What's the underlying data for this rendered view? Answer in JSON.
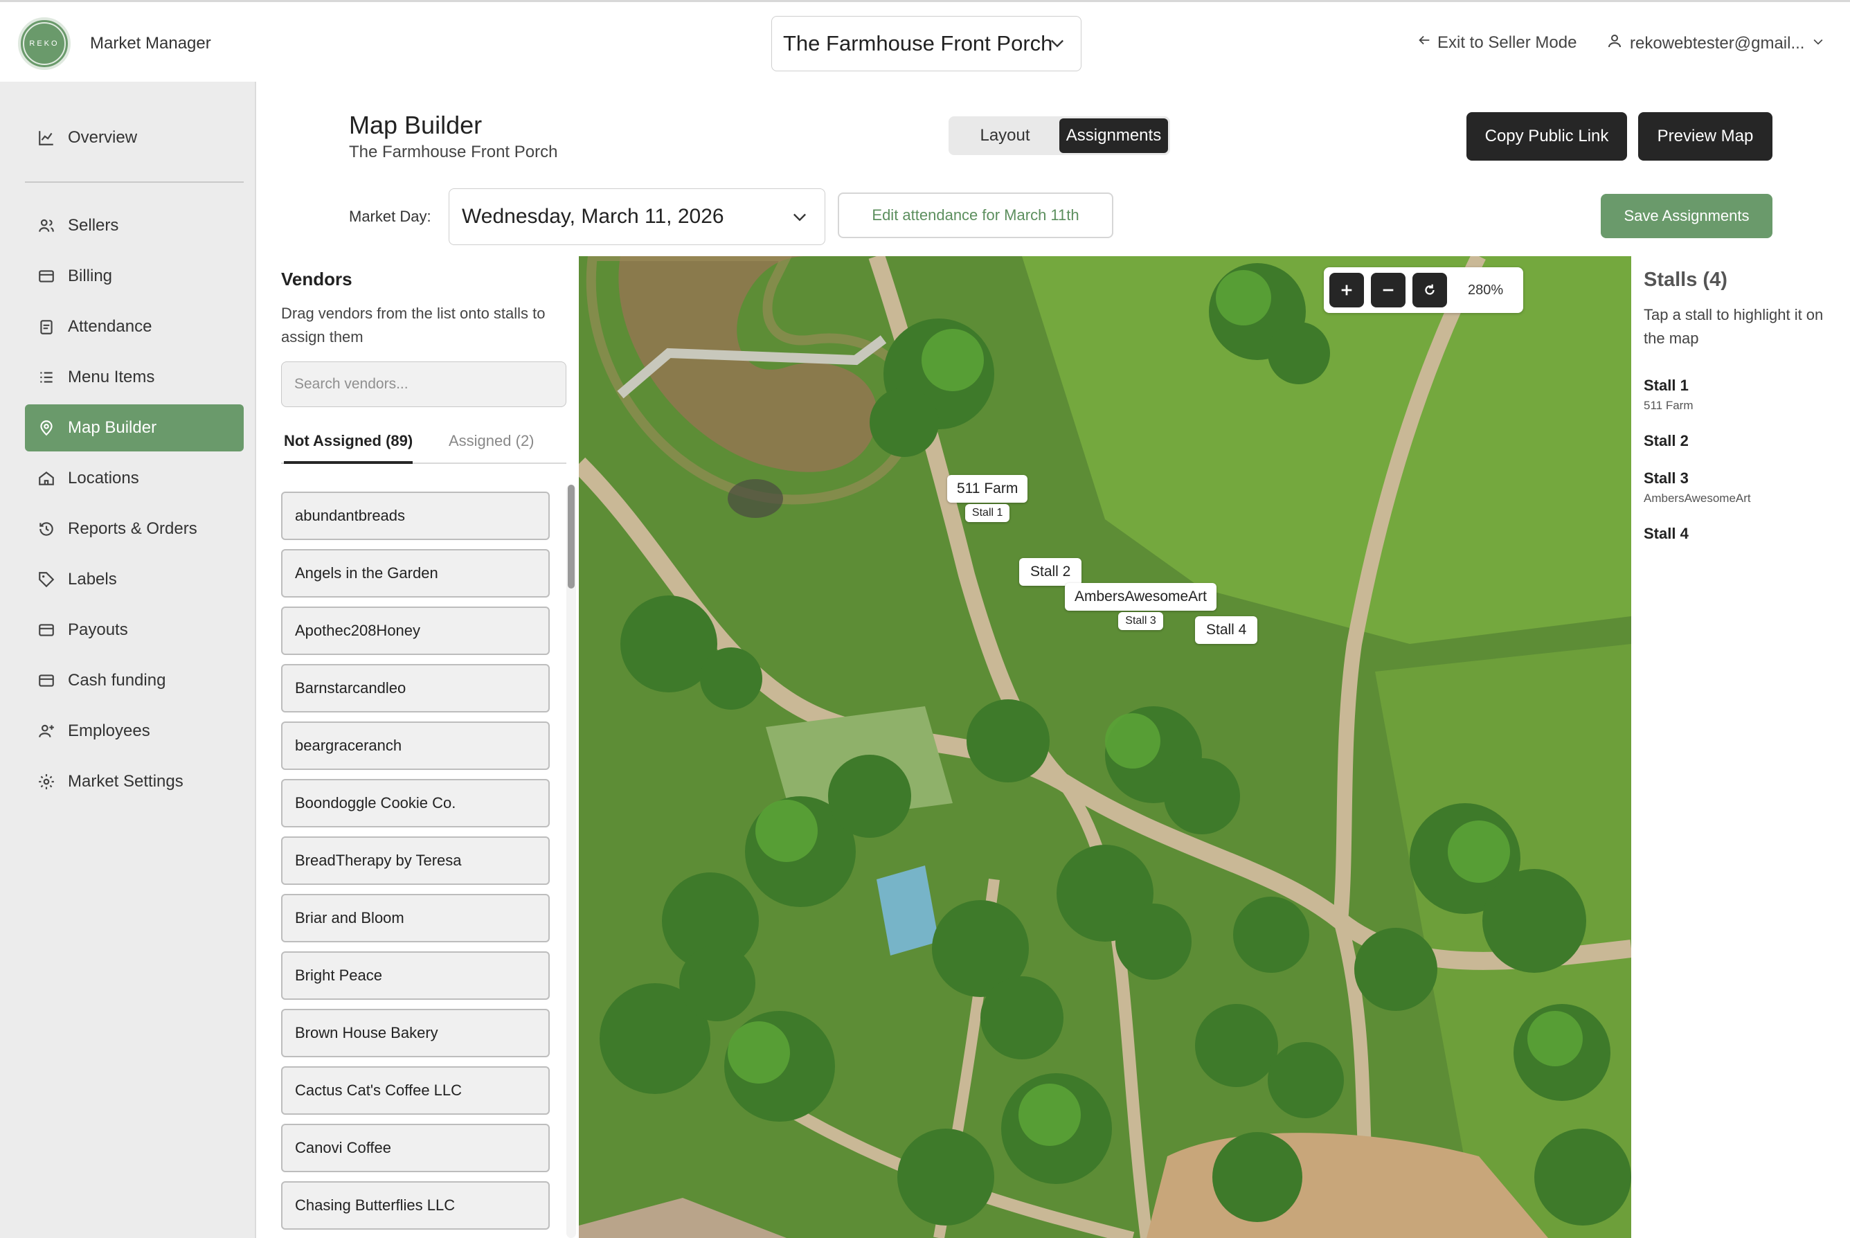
{
  "header": {
    "logo_text": "REKO",
    "app_title": "Market Manager",
    "market_name": "The Farmhouse Front Porch",
    "exit_label": "Exit to Seller Mode",
    "user_email": "rekowebtester@gmail..."
  },
  "sidebar": {
    "items": [
      {
        "label": "Overview",
        "icon": "chart-line-icon"
      },
      {
        "label": "Sellers",
        "icon": "users-icon"
      },
      {
        "label": "Billing",
        "icon": "credit-card-icon"
      },
      {
        "label": "Attendance",
        "icon": "clipboard-icon"
      },
      {
        "label": "Menu Items",
        "icon": "list-icon"
      },
      {
        "label": "Map Builder",
        "icon": "map-pin-icon"
      },
      {
        "label": "Locations",
        "icon": "home-icon"
      },
      {
        "label": "Reports & Orders",
        "icon": "history-icon"
      },
      {
        "label": "Labels",
        "icon": "tag-icon"
      },
      {
        "label": "Payouts",
        "icon": "credit-card-icon"
      },
      {
        "label": "Cash funding",
        "icon": "credit-card-icon"
      },
      {
        "label": "Employees",
        "icon": "user-plus-icon"
      },
      {
        "label": "Market Settings",
        "icon": "gear-icon"
      }
    ],
    "active": "Map Builder"
  },
  "page": {
    "title": "Map Builder",
    "subtitle": "The Farmhouse Front Porch",
    "tabs": [
      {
        "label": "Layout"
      },
      {
        "label": "Assignments"
      }
    ],
    "active_tab": "Assignments",
    "copy_link_label": "Copy Public Link",
    "preview_label": "Preview Map",
    "market_day_label": "Market Day:",
    "market_day_value": "Wednesday, March 11, 2026",
    "edit_attendance_label": "Edit attendance for March 11th",
    "save_label": "Save Assignments"
  },
  "vendors": {
    "title": "Vendors",
    "help": "Drag vendors from the list onto stalls to assign them",
    "search_placeholder": "Search vendors...",
    "tab_not_assigned": "Not Assigned (89)",
    "tab_assigned": "Assigned (2)",
    "list": [
      "abundantbreads",
      "Angels in the Garden",
      "Apothec208Honey",
      "Barnstarcandleo",
      "beargraceranch",
      "Boondoggle Cookie Co.",
      "BreadTherapy by Teresa",
      "Briar and Bloom",
      "Bright Peace",
      "Brown House Bakery",
      "Cactus Cat's Coffee LLC",
      "Canovi Coffee",
      "Chasing Butterflies LLC"
    ]
  },
  "map": {
    "zoom_label": "280%",
    "markers": [
      {
        "vendor": "511 Farm",
        "stall": "Stall 1"
      },
      {
        "stall": "Stall 2"
      },
      {
        "vendor": "AmbersAwesomeArt",
        "stall": "Stall 3"
      },
      {
        "stall": "Stall 4"
      }
    ]
  },
  "stalls": {
    "title": "Stalls (4)",
    "help": "Tap a stall to highlight it on the map",
    "list": [
      {
        "name": "Stall 1",
        "vendor": "511 Farm"
      },
      {
        "name": "Stall 2",
        "vendor": ""
      },
      {
        "name": "Stall 3",
        "vendor": "AmbersAwesomeArt"
      },
      {
        "name": "Stall 4",
        "vendor": ""
      }
    ]
  },
  "colors": {
    "accent_green": "#6a9a6b",
    "dark_button": "#262626",
    "sidebar_bg": "#ececec"
  }
}
